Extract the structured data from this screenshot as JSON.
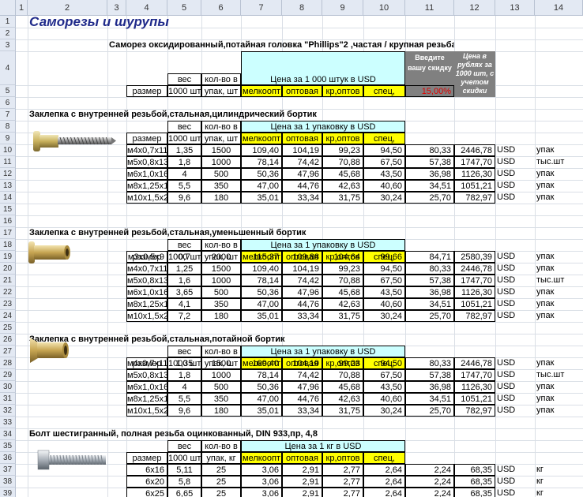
{
  "columns": [
    "1",
    "2",
    "3",
    "4",
    "5",
    "6",
    "7",
    "8",
    "9",
    "10",
    "11",
    "12",
    "13",
    "14"
  ],
  "rows": [
    "1",
    "2",
    "3",
    "4",
    "5",
    "6",
    "7",
    "8",
    "9",
    "10",
    "11",
    "12",
    "13",
    "14",
    "15",
    "16",
    "17",
    "18",
    "19",
    "20",
    "21",
    "22",
    "23",
    "24",
    "25",
    "26",
    "27",
    "28",
    "29",
    "30",
    "31",
    "32",
    "33",
    "34",
    "35",
    "36",
    "37",
    "38",
    "39",
    "40"
  ],
  "title": "Саморезы и шурупы",
  "sec0": {
    "heading": "Саморез оксидированный,потайная головка \"Phillips\"2 ,частая / крупная резьба",
    "h_ves": "вес",
    "h_kol": "кол-во в",
    "h_price": "Цена за 1 000 штук в USD",
    "h_discount": "Введите вашу скидку",
    "h_rub": "Цена в рублях за 1000 шт, с учетом скидки",
    "h_size": "размер",
    "h_1000": "1000 шт",
    "h_upak": "упак, шт",
    "h_melko": "мелкоопт",
    "h_opt": "оптовая",
    "h_kropt": "кр,оптов",
    "h_spec": "спец,",
    "discount": "15,00%"
  },
  "sections": [
    {
      "heading": "Заклепка с внутренней резьбой,стальная,цилиндрический бортик",
      "h_ves": "вес",
      "h_kol": "кол-во в",
      "h_price": "Цена за 1 упаковку в USD",
      "h_size": "размер",
      "h_1000": "1000 шт",
      "h_upak": "упак, шт",
      "h_melko": "мелкоопт",
      "h_opt": "оптовая",
      "h_kropt": "кр,оптов",
      "h_spec": "спец,",
      "rows": [
        {
          "size": "м4х0,7х11,6",
          "ves": "1,35",
          "kol": "1500",
          "p1": "109,40",
          "p2": "104,19",
          "p3": "99,23",
          "p4": "94,50",
          "d": "80,33",
          "rub": "2446,78",
          "cur": "USD",
          "unit": "упак"
        },
        {
          "size": "м5х0,8х13",
          "ves": "1,8",
          "kol": "1000",
          "p1": "78,14",
          "p2": "74,42",
          "p3": "70,88",
          "p4": "67,50",
          "d": "57,38",
          "rub": "1747,70",
          "cur": "USD",
          "unit": "тыс.шт"
        },
        {
          "size": "м6х1,0х16",
          "ves": "4",
          "kol": "500",
          "p1": "50,36",
          "p2": "47,96",
          "p3": "45,68",
          "p4": "43,50",
          "d": "36,98",
          "rub": "1126,30",
          "cur": "USD",
          "unit": "упак"
        },
        {
          "size": "м8х1,25х18",
          "ves": "5,5",
          "kol": "350",
          "p1": "47,00",
          "p2": "44,76",
          "p3": "42,63",
          "p4": "40,60",
          "d": "34,51",
          "rub": "1051,21",
          "cur": "USD",
          "unit": "упак"
        },
        {
          "size": "м10х1,5х21",
          "ves": "9,6",
          "kol": "180",
          "p1": "35,01",
          "p2": "33,34",
          "p3": "31,75",
          "p4": "30,24",
          "d": "25,70",
          "rub": "782,97",
          "cur": "USD",
          "unit": "упак"
        }
      ]
    },
    {
      "heading": "Заклепка с внутренней резьбой,стальная,уменьшенный бортик",
      "h_ves": "вес",
      "h_kol": "кол-во в",
      "h_price": "Цена за 1 упаковку в USD",
      "h_size": "размер",
      "h_1000": "1000 шт",
      "h_upak": "упак, шт",
      "h_melko": "мелкоопт",
      "h_opt": "оптовая",
      "h_kropt": "кр,оптов",
      "h_spec": "спец,",
      "rows": [
        {
          "size": "м3х0,5х9",
          "ves": "0,7",
          "kol": "2000",
          "p1": "115,37",
          "p2": "109,88",
          "p3": "104,64",
          "p4": "99,66",
          "d": "84,71",
          "rub": "2580,39",
          "cur": "USD",
          "unit": "упак"
        },
        {
          "size": "м4х0,7х11,6",
          "ves": "1,25",
          "kol": "1500",
          "p1": "109,40",
          "p2": "104,19",
          "p3": "99,23",
          "p4": "94,50",
          "d": "80,33",
          "rub": "2446,78",
          "cur": "USD",
          "unit": "упак"
        },
        {
          "size": "м5х0,8х13",
          "ves": "1,6",
          "kol": "1000",
          "p1": "78,14",
          "p2": "74,42",
          "p3": "70,88",
          "p4": "67,50",
          "d": "57,38",
          "rub": "1747,70",
          "cur": "USD",
          "unit": "тыс.шт"
        },
        {
          "size": "м6х1,0х16",
          "ves": "3,65",
          "kol": "500",
          "p1": "50,36",
          "p2": "47,96",
          "p3": "45,68",
          "p4": "43,50",
          "d": "36,98",
          "rub": "1126,30",
          "cur": "USD",
          "unit": "упак"
        },
        {
          "size": "м8х1,25х18",
          "ves": "4,1",
          "kol": "350",
          "p1": "47,00",
          "p2": "44,76",
          "p3": "42,63",
          "p4": "40,60",
          "d": "34,51",
          "rub": "1051,21",
          "cur": "USD",
          "unit": "упак"
        },
        {
          "size": "м10х1,5х21",
          "ves": "7,2",
          "kol": "180",
          "p1": "35,01",
          "p2": "33,34",
          "p3": "31,75",
          "p4": "30,24",
          "d": "25,70",
          "rub": "782,97",
          "cur": "USD",
          "unit": "упак"
        }
      ]
    },
    {
      "heading": "Заклепка с внутренней резьбой,стальная,потайной бортик",
      "h_ves": "вес",
      "h_kol": "кол-во в",
      "h_price": "Цена за 1 упаковку в USD",
      "h_size": "размер",
      "h_1000": "1000 шт",
      "h_upak": "упак, шт",
      "h_melko": "мелкоопт",
      "h_opt": "оптовая",
      "h_kropt": "кр,оптов",
      "h_spec": "спец,",
      "rows": [
        {
          "size": "м4х0,7х11,6",
          "ves": "1,35",
          "kol": "1500",
          "p1": "109,40",
          "p2": "104,19",
          "p3": "99,23",
          "p4": "94,50",
          "d": "80,33",
          "rub": "2446,78",
          "cur": "USD",
          "unit": "упак"
        },
        {
          "size": "м5х0,8х13",
          "ves": "1,8",
          "kol": "1000",
          "p1": "78,14",
          "p2": "74,42",
          "p3": "70,88",
          "p4": "67,50",
          "d": "57,38",
          "rub": "1747,70",
          "cur": "USD",
          "unit": "тыс.шт"
        },
        {
          "size": "м6х1,0х16",
          "ves": "4",
          "kol": "500",
          "p1": "50,36",
          "p2": "47,96",
          "p3": "45,68",
          "p4": "43,50",
          "d": "36,98",
          "rub": "1126,30",
          "cur": "USD",
          "unit": "упак"
        },
        {
          "size": "м8х1,25х18",
          "ves": "5,5",
          "kol": "350",
          "p1": "47,00",
          "p2": "44,76",
          "p3": "42,63",
          "p4": "40,60",
          "d": "34,51",
          "rub": "1051,21",
          "cur": "USD",
          "unit": "упак"
        },
        {
          "size": "м10х1,5х21",
          "ves": "9,6",
          "kol": "180",
          "p1": "35,01",
          "p2": "33,34",
          "p3": "31,75",
          "p4": "30,24",
          "d": "25,70",
          "rub": "782,97",
          "cur": "USD",
          "unit": "упак"
        }
      ]
    },
    {
      "heading": "Болт шестигранный, полная резьба    оцинкованный, DIN 933,пр, 4,8",
      "h_ves": "вес",
      "h_kol": "кол-во в",
      "h_price": "Цена за 1 кг в USD",
      "h_size": "размер",
      "h_1000": "1000 шт",
      "h_upak": "упак, кг",
      "h_melko": "мелкоопт",
      "h_opt": "оптовая",
      "h_kropt": "кр,оптов",
      "h_spec": "спец,",
      "rows": [
        {
          "size": "6х16",
          "ves": "5,11",
          "kol": "25",
          "p1": "3,06",
          "p2": "2,91",
          "p3": "2,77",
          "p4": "2,64",
          "d": "2,24",
          "rub": "68,35",
          "cur": "USD",
          "unit": "кг"
        },
        {
          "size": "6х20",
          "ves": "5,8",
          "kol": "25",
          "p1": "3,06",
          "p2": "2,91",
          "p3": "2,77",
          "p4": "2,64",
          "d": "2,24",
          "rub": "68,35",
          "cur": "USD",
          "unit": "кг"
        },
        {
          "size": "6х25",
          "ves": "6,65",
          "kol": "25",
          "p1": "3,06",
          "p2": "2,91",
          "p3": "2,77",
          "p4": "2,64",
          "d": "2,24",
          "rub": "68,35",
          "cur": "USD",
          "unit": "кг"
        }
      ]
    }
  ]
}
